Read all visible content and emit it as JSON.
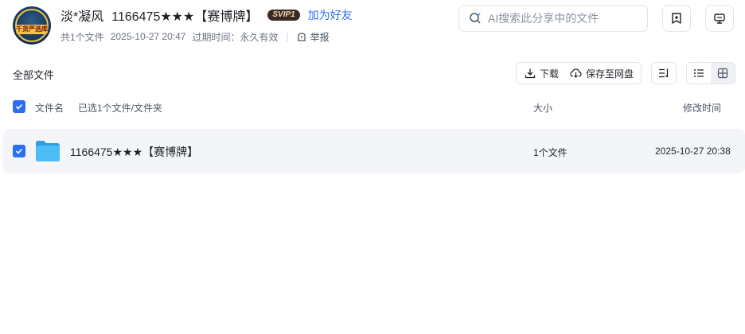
{
  "sharer": {
    "name": "淡*凝风",
    "avatar_text": "千货严选库",
    "share_title": "1166475★★★【赛博牌】",
    "vip_badge": "SVIP1",
    "add_friend": "加为好友"
  },
  "meta": {
    "file_count": "共1个文件",
    "shared_at": "2025-10-27 20:47",
    "expire_label": "过期时间：",
    "expire_value": "永久有效",
    "report": "举报"
  },
  "search": {
    "placeholder": "AI搜索此分享中的文件"
  },
  "toolbar": {
    "section_title": "全部文件",
    "download": "下载",
    "save": "保存至网盘"
  },
  "columns": {
    "name": "文件名",
    "selected": "已选1个文件/文件夹",
    "size": "大小",
    "modified": "修改时间"
  },
  "files": [
    {
      "name": "1166475★★★【赛博牌】",
      "size": "1个文件",
      "modified": "2025-10-27 20:38",
      "type": "folder",
      "checked": true
    }
  ],
  "colors": {
    "accent": "#2b6ff2",
    "folder": "#41b4f5",
    "row_bg": "#f4f5f8",
    "vip_bg": "#3b2a22",
    "vip_text": "#f6d7b0"
  },
  "icons": [
    "search-icon",
    "bookmark-add-icon",
    "monitor-icon",
    "report-icon",
    "download-icon",
    "cloud-save-icon",
    "sort-icon",
    "list-view-icon",
    "grid-view-icon",
    "folder-icon",
    "checkbox-icon"
  ]
}
